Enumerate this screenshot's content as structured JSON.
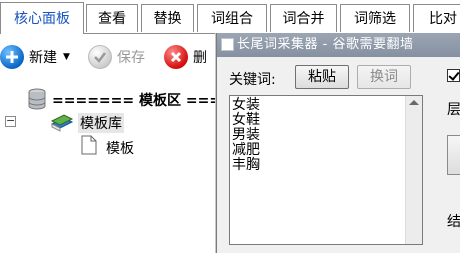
{
  "tabs": [
    "核心面板",
    "查看",
    "替换",
    "词组合",
    "词合并",
    "词筛选",
    "比对"
  ],
  "active_tab": 0,
  "toolbar": {
    "new_label": "新建",
    "save_label": "保存",
    "delete_label": "删"
  },
  "tree": {
    "header": "======= 模板区 ====",
    "library": "模板库",
    "template": "模板",
    "expander": "−"
  },
  "dialog": {
    "title": "长尾词采集器 - 谷歌需要翻墙",
    "keyword_label": "关键词:",
    "paste_button": "粘贴",
    "dedupe_button": "换词",
    "keywords": [
      "女装",
      "女鞋",
      "男装",
      "减肥",
      "丰胸"
    ],
    "right_label_1": "层",
    "right_label_2": "结"
  },
  "colors": {
    "active_tab_text": "#1a55c0",
    "title_bar": "#8f9aab"
  }
}
